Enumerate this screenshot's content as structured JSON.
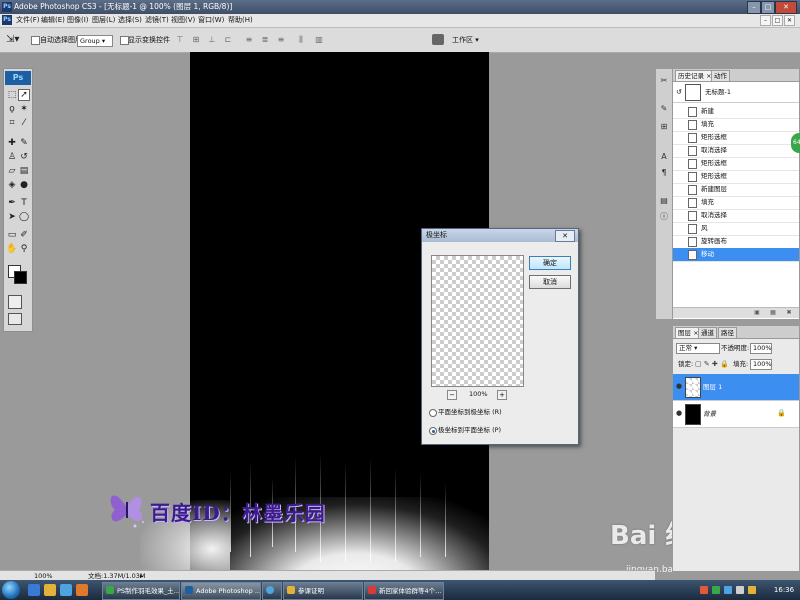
{
  "app": {
    "title": "Adobe Photoshop CS3 - [无标题-1 @ 100% (图层 1, RGB/8)]",
    "logo_text": "Ps",
    "mini_logo": "Ps"
  },
  "window_controls": {
    "minimize": "–",
    "maximize": "□",
    "close": "✕"
  },
  "menu": {
    "items": [
      "文件(F)",
      "编辑(E)",
      "图像(I)",
      "图层(L)",
      "选择(S)",
      "滤镜(T)",
      "视图(V)",
      "窗口(W)",
      "帮助(H)"
    ]
  },
  "options_bar": {
    "auto_select_label": "自动选择图层",
    "auto_select_value": "Group",
    "transform_label": "显示变换控件",
    "workspace_label": "工作区 ▾"
  },
  "dialog": {
    "title": "极坐标",
    "ok_label": "确定",
    "cancel_label": "取消",
    "zoom_out": "−",
    "zoom_value": "100%",
    "zoom_in": "+",
    "options": [
      {
        "label": "平面坐标到极坐标 (R)",
        "selected": false
      },
      {
        "label": "极坐标到平面坐标 (P)",
        "selected": true
      }
    ],
    "close": "✕"
  },
  "history": {
    "tabs": [
      "历史记录",
      "动作"
    ],
    "snapshot_name": "无标题-1",
    "items": [
      {
        "label": "新建",
        "selected": false
      },
      {
        "label": "填充",
        "selected": false
      },
      {
        "label": "矩形选框",
        "selected": false
      },
      {
        "label": "取消选择",
        "selected": false
      },
      {
        "label": "矩形选框",
        "selected": false
      },
      {
        "label": "矩形选框",
        "selected": false
      },
      {
        "label": "新建图层",
        "selected": false
      },
      {
        "label": "填充",
        "selected": false
      },
      {
        "label": "取消选择",
        "selected": false
      },
      {
        "label": "风",
        "selected": false
      },
      {
        "label": "旋转画布",
        "selected": false
      },
      {
        "label": "移动",
        "selected": true
      }
    ]
  },
  "layers": {
    "tabs": [
      "图层",
      "通道",
      "路径"
    ],
    "blend_mode": "正常",
    "opacity_label": "不透明度:",
    "opacity_value": "100%",
    "lock_label": "锁定:",
    "fill_label": "填充:",
    "fill_value": "100%",
    "items": [
      {
        "name": "图层 1",
        "selected": true
      },
      {
        "name": "背景",
        "selected": false
      }
    ]
  },
  "status": {
    "zoom": "100%",
    "doc_info": "文档:1.37M/1.03M"
  },
  "watermark": {
    "text": "百度ID：林墨乐园",
    "baidu_logo": "Bai 经验",
    "baidu_url": "jingyan.baidu.com"
  },
  "taskbar": {
    "buttons": [
      {
        "label": "PS制作羽毛效果_土...",
        "active": false
      },
      {
        "label": "Adobe Photoshop ...",
        "active": true
      },
      {
        "label": "",
        "active": false
      },
      {
        "label": "参课证明",
        "active": false
      },
      {
        "label": "新回家体验群等4个...",
        "active": false
      }
    ],
    "clock": "16:36",
    "side_tab": "64"
  },
  "colors": {
    "accent": "#3c8ef1",
    "titlebar": "#4a5b76",
    "canvas": "#000000",
    "watermark": "#3c1c8a"
  },
  "icons": {
    "tools": [
      "move-tool-icon",
      "marquee-icon",
      "lasso-icon",
      "magic-wand-icon",
      "crop-icon",
      "slice-icon",
      "healing-brush-icon",
      "brush-icon",
      "clone-stamp-icon",
      "history-brush-icon",
      "eraser-icon",
      "gradient-icon",
      "blur-icon",
      "dodge-icon",
      "pen-icon",
      "type-icon",
      "path-selection-icon",
      "shape-icon",
      "notes-icon",
      "eyedropper-icon",
      "hand-icon",
      "zoom-icon"
    ]
  }
}
